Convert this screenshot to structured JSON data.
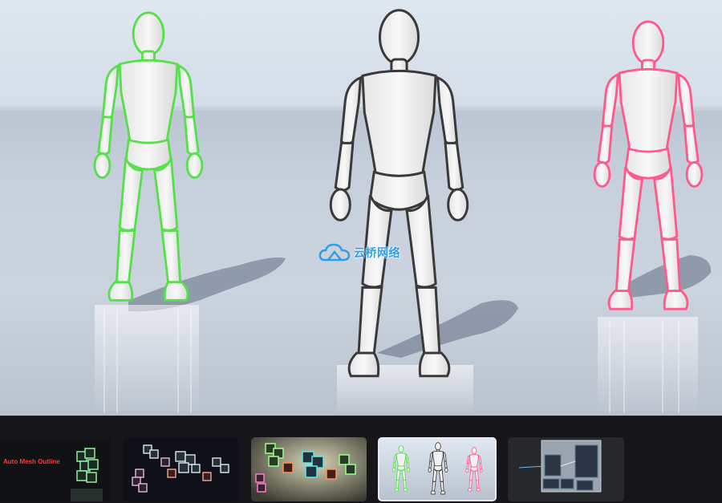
{
  "watermark": {
    "text": "云桥网络"
  },
  "viewer": {
    "figures": [
      {
        "id": "left",
        "outline": "green",
        "outline_color": "#56e04a"
      },
      {
        "id": "center",
        "outline": "dark",
        "outline_color": "#3a3a3a"
      },
      {
        "id": "right",
        "outline": "pink",
        "outline_color": "#ff5a8c"
      }
    ]
  },
  "gallery": {
    "thumbnails": [
      {
        "id": "thumb-1",
        "caption": "Auto Mesh Outline",
        "active": false
      },
      {
        "id": "thumb-2",
        "caption": "",
        "active": false
      },
      {
        "id": "thumb-3",
        "caption": "",
        "active": false
      },
      {
        "id": "thumb-4",
        "caption": "",
        "active": true
      },
      {
        "id": "thumb-5",
        "caption": "",
        "active": false
      }
    ]
  },
  "colors": {
    "accent_green": "#56e04a",
    "accent_pink": "#ff5a8c",
    "accent_cyan": "#4fd6e6",
    "accent_red": "#ff3a3a",
    "strip_bg": "#16161a"
  }
}
